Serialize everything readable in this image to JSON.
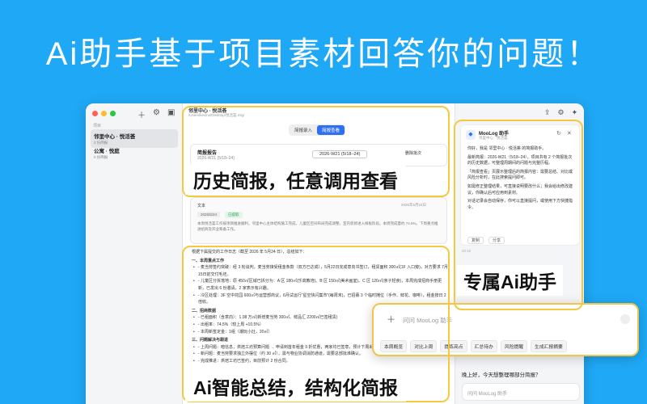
{
  "headline": "Ai助手基于项目素材回答你的问题！",
  "colors": {
    "background": "#1fa8f5",
    "accent": "#2f6ff3",
    "highlight": "#f5c842",
    "tag_green": "#2a9d55"
  },
  "sidebar": {
    "label": "项目",
    "projects": [
      {
        "name": "邻里中心 · 悦活荟",
        "sub": "2 份简报"
      },
      {
        "name": "公寓 · 悦庭",
        "sub": "0 份简报"
      }
    ],
    "icons": [
      "plus-icon",
      "gear-icon",
      "sidebar-icon"
    ]
  },
  "main": {
    "title": "邻里中心 · 悦活荟",
    "path": "/Users/kevinx/Desktop/悦活荟.mlg/",
    "tabs": [
      "简报录入",
      "简报查看"
    ],
    "active_tab": 1,
    "brief_header": {
      "title": "简报报告",
      "date": "2026-W21 (5/18–24)",
      "week_select": "2026-W21 (5/18–24)",
      "delete": "删除批次"
    },
    "file": {
      "label": "文本",
      "date": "2026年5月24日",
      "tag1": "2026/5/24",
      "tag2": "已提取",
      "content": "本周悦活荟工作按项目推进顺利，邻里中心主体结构施工完成，儿童区空间布局完成调整，室内装修进入样板阶段。本周完成量约 74.5%，下周重点推进招商及开业筹备工作。"
    },
    "summary": {
      "intro": "根据下属提交的工作日志（截至 2026 年 5月24 日），总结如下：",
      "sections": [
        {
          "heading": "一、本周重点工作",
          "items": [
            "- 麦当劳签约突破：经 3 轮谈判，麦当劳接受租金条款（双方已达成），5月22日完成意向书签订，租赁面积 300㎡(1F 入口旁)，对方要求 7月15日前交付毛坯。",
            "- 儿童区分拆落地：原 450㎡区域已拆分为：A 区 180㎡(乐高教培)、B 区 150㎡(美术画室)、C 区 120㎡(亲子轻食)，本周完成招商手册更新，已发出 6 份邀请，2 家表示有兴趣。",
            "- 冷区处理：3F 空中花园 600㎡与运营部商议，6月试运行“星空快闪集市”(每周末)，已招募 3 个临时摊位（手作、鲜花、咖啡），租金按日 2 倍收。"
          ]
        },
        {
          "heading": "二、招商数据",
          "items": [
            "- 已租面积（含意向）：1.08 万㎡(新增麦当劳 300㎡、鲜品汇 2200㎡已签租赁)",
            "- 出租率：74.5%（较上周 +10.5%）",
            "- 本周新签定金：1组（潮玩小灶，20㎡）"
          ]
        },
        {
          "heading": "三、问题解决与跟进",
          "items": [
            "- 上周问题：暗信息，烘焙工坊预算问题 → 申请到首年租金 9 折优惠，两家均已签意，预计下周出价。",
            "- 新问题：麦当劳要求独立外摆位（约 30 ㎡），需与物业协调消防通道，需要总部批准确认。",
            "- 完成推进：烘焙工坊已签约，目前预计 2 份合同。"
          ]
        }
      ]
    }
  },
  "chat": {
    "window_icons": [
      "export-icon",
      "settings-icon",
      "sparkle-icon"
    ],
    "bot_name": "MooLog 助手",
    "bot_sub": "邻里中心 · 悦活荟",
    "messages": [
      "你好，我是 邻里中心 · 悦活荟 的简报助手。",
      "最新简报：2026-W21（5/18–24），项目共有 2 个简报批次的历史数据，可整理周期间的问题与完整历程。",
      "「简报查看」页展示整理后的简报内容：需要总结、对比或风险分析时，在此搜索提问即可。",
      "如需修正整理结果，可直接说明要改什么；我会给出修改建议，你确认后可应用到素材。",
      "对话记录会自动保存，你可以直接提问，或使用下方快捷指令。"
    ],
    "copy": "复制",
    "share": "分享",
    "time": "20:10",
    "question": "晚上好，今天想整理哪部分简报？",
    "input_placeholder": "问问 MooLog 助手"
  },
  "floating_input": {
    "placeholder": "问问 MooLog 助手",
    "chips": [
      "本周概览",
      "对比上周",
      "提炼亮点",
      "汇总待办",
      "风险提醒",
      "生成汇报摘要"
    ]
  },
  "banners": [
    "历史简报，任意调用查看",
    "专属Ai助手",
    "Ai智能总结，结构化简报"
  ]
}
